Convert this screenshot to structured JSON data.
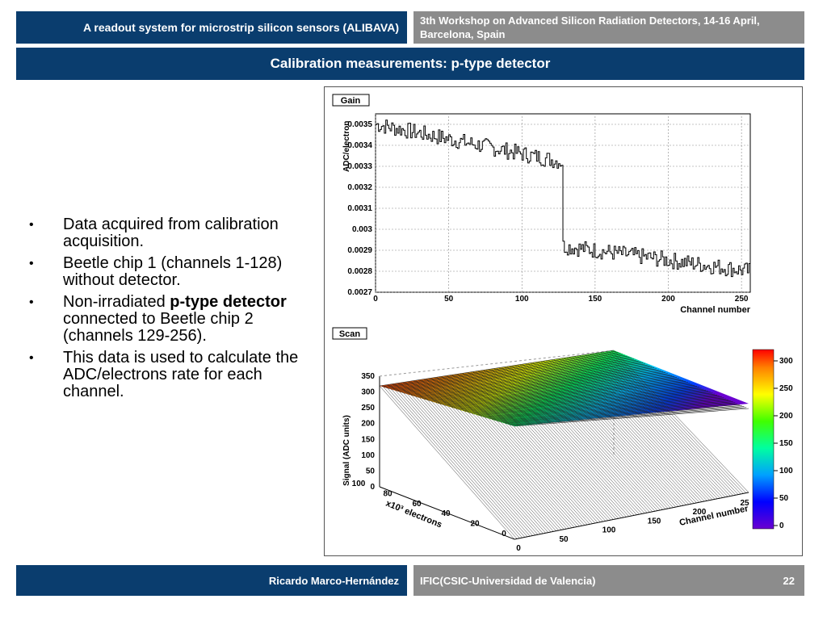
{
  "header": {
    "left_title": "A readout system for microstrip silicon sensors (ALIBAVA)",
    "right_line1": "3th Workshop on Advanced Silicon Radiation Detectors, 14-16 April,",
    "right_line2": "Barcelona, Spain"
  },
  "slide_title": "Calibration measurements: p-type detector",
  "bullets": [
    {
      "text": "Data acquired from calibration acquisition."
    },
    {
      "text": "Beetle chip 1 (channels 1-128) without detector."
    },
    {
      "pre": "Non-irradiated ",
      "bold": "p-type detector",
      "post": " connected to Beetle chip 2 (channels 129-256)."
    },
    {
      "text": "This data is used to calculate the ADC/electrons rate for each channel."
    }
  ],
  "chart_data": [
    {
      "type": "line",
      "title": "Gain",
      "ylabel": "ADC/electron",
      "xlabel": "Channel number",
      "xlim": [
        0,
        256
      ],
      "ylim": [
        0.0027,
        0.00355
      ],
      "xticks": [
        "0",
        "50",
        "100",
        "150",
        "200",
        "250"
      ],
      "yticks": [
        "0.0027",
        "0.0028",
        "0.0029",
        "0.003",
        "0.0031",
        "0.0032",
        "0.0033",
        "0.0034",
        "0.0035"
      ],
      "grid": true,
      "segments": [
        {
          "x_start": 0,
          "x_end": 128,
          "y_start": 0.0035,
          "y_end": 0.00332
        },
        {
          "x_start": 128,
          "x_end": 256,
          "y_start": 0.00292,
          "y_end": 0.0028
        }
      ]
    },
    {
      "type": "surface",
      "title": "Scan",
      "zlabel": "Signal (ADC units)",
      "ylabel": "x10³ electrons",
      "xlabel": "Channel number",
      "zticks": [
        "0",
        "50",
        "100",
        "150",
        "200",
        "250",
        "300",
        "350"
      ],
      "yticks": [
        "0",
        "20",
        "40",
        "60",
        "80",
        "100"
      ],
      "xticks": [
        "0",
        "50",
        "100",
        "150",
        "200",
        "25"
      ],
      "colorbar_ticks": [
        "0",
        "50",
        "100",
        "150",
        "200",
        "250",
        "300"
      ],
      "colors": [
        "#6a00d0",
        "#0000ff",
        "#0080ff",
        "#00c0ff",
        "#00e0a0",
        "#00ff40",
        "#a0ff00",
        "#ffff00",
        "#ffc000",
        "#ff8000",
        "#ff4000",
        "#ff0000"
      ]
    }
  ],
  "footer": {
    "author": "Ricardo Marco-Hernández",
    "institution": "IFIC(CSIC-Universidad de Valencia)",
    "page": "22"
  }
}
